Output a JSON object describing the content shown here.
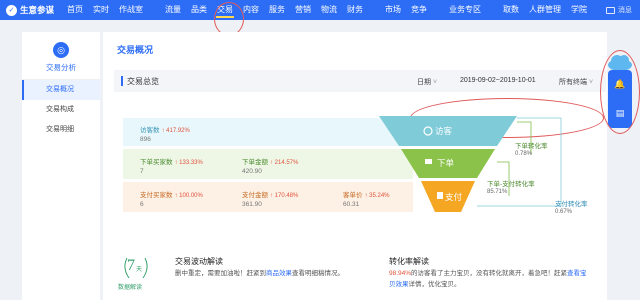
{
  "app": {
    "name": "生意参谋"
  },
  "nav": {
    "items": [
      "首页",
      "实时",
      "作战室",
      "流量",
      "品类",
      "交易",
      "内容",
      "服务",
      "营销",
      "物流",
      "财务",
      "市场",
      "竞争",
      "业务专区",
      "取数",
      "人群管理",
      "学院"
    ],
    "active": "交易",
    "user": "消息"
  },
  "sidebar": {
    "section_label": "交易分析",
    "items": [
      {
        "label": "交易概况",
        "active": true
      },
      {
        "label": "交易构成",
        "active": false
      },
      {
        "label": "交易明细",
        "active": false
      }
    ]
  },
  "main": {
    "title": "交易概况",
    "overview_title": "交易总览",
    "date_label": "日期",
    "date_range": "2019-09-02~2019-10-01",
    "terminal": "所有终端"
  },
  "funnel": {
    "visitors": {
      "label": "访客数",
      "pct": "417.92%",
      "value": "896"
    },
    "order_buyers": {
      "label": "下单买家数",
      "pct": "133.33%",
      "value": "7"
    },
    "order_amount": {
      "label": "下单金额",
      "pct": "214.57%",
      "value": "420.90"
    },
    "pay_buyers": {
      "label": "支付买家数",
      "pct": "100.00%",
      "value": "6"
    },
    "pay_amount": {
      "label": "支付金额",
      "pct": "170.48%",
      "value": "361.90"
    },
    "unit_price": {
      "label": "客单价",
      "pct": "35.24%",
      "value": "60.31"
    },
    "stages": [
      "访客",
      "下单",
      "支付"
    ],
    "rates": {
      "order_conv": {
        "label": "下单转化率",
        "value": "0.78%"
      },
      "order_pay_conv": {
        "label": "下单-支付转化率",
        "value": "85.71%"
      },
      "pay_conv": {
        "label": "支付转化率",
        "value": "0.67%"
      }
    }
  },
  "bottom": {
    "seven_num": "7",
    "seven_unit": "天",
    "seven_text": "数据解读",
    "wave_title": "交易波动解读",
    "wave_text_1": "删中重定，需要加油啦！赶紧到",
    "wave_link": "商品效果",
    "wave_text_2": "查看明细稿情况。",
    "conv_title": "转化率解读",
    "conv_pct": "98.94%",
    "conv_text_1": "的访客看了主力宝贝，没有转化就离开，着急吧！赶紧",
    "conv_link": "查看宝贝效果",
    "conv_text_2": "详情，优化宝贝。"
  },
  "colors": {
    "brand": "#2d6df6",
    "visitor": "#7fcbd8",
    "order": "#8bc34a",
    "pay": "#f5a623",
    "annotation": "#e05a5a"
  }
}
